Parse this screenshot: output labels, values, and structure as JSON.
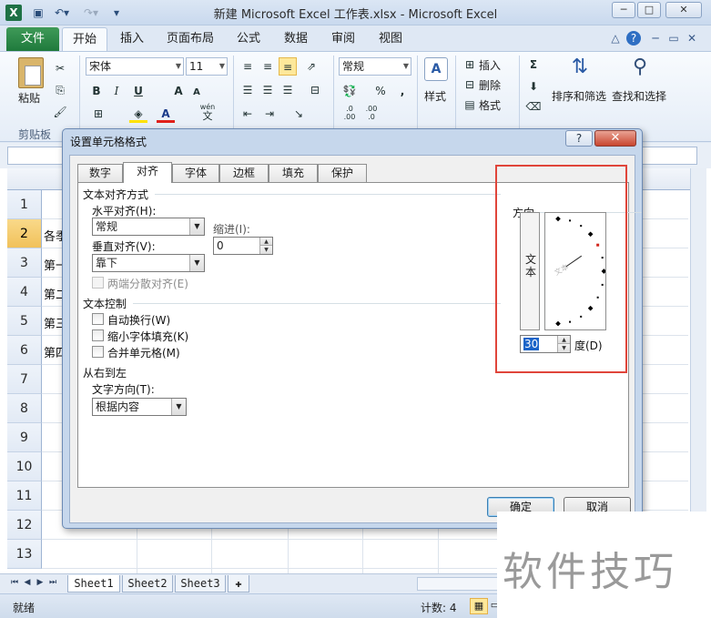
{
  "window": {
    "app_icon": "X",
    "title": "新建 Microsoft Excel 工作表.xlsx - Microsoft Excel",
    "qat": [
      "save-icon",
      "undo-icon",
      "redo-icon",
      "customize-icon"
    ]
  },
  "ribbon_tabs": {
    "file": "文件",
    "items": [
      "开始",
      "插入",
      "页面布局",
      "公式",
      "数据",
      "审阅",
      "视图"
    ]
  },
  "ribbon": {
    "paste": "粘贴",
    "clipboard": "剪贴板",
    "font_name": "宋体",
    "font_size": "11",
    "number_format": "常规",
    "styles": "样式",
    "insert": "插入",
    "delete": "删除",
    "format": "格式",
    "sort_filter": "排序和筛选",
    "find_select": "查找和选择",
    "bold": "B",
    "italic": "I",
    "underline": "U",
    "grow_font": "A",
    "shrink_font": "A",
    "wen": "wén",
    "wen_char": "文",
    "percent": "%",
    "comma": ",",
    "dec_inc": ".0\n.00",
    "dec_dec": ".00\n.0",
    "sigma": "Σ"
  },
  "grid": {
    "rows": [
      "1",
      "2",
      "3",
      "4",
      "5",
      "6",
      "7",
      "8",
      "9",
      "10",
      "11",
      "12",
      "13"
    ],
    "selected_row": "2",
    "cells": [
      "各季",
      "第一",
      "第二",
      "第三",
      "第四"
    ]
  },
  "sheets": [
    "Sheet1",
    "Sheet2",
    "Sheet3"
  ],
  "status": {
    "ready": "就绪",
    "count": "计数: 4"
  },
  "dialog": {
    "title": "设置单元格格式",
    "help": "?",
    "close": "✕",
    "tabs": [
      "数字",
      "对齐",
      "字体",
      "边框",
      "填充",
      "保护"
    ],
    "active_tab": "对齐",
    "text_alignment": {
      "title": "文本对齐方式",
      "horizontal_label": "水平对齐(H):",
      "horizontal_value": "常规",
      "vertical_label": "垂直对齐(V):",
      "vertical_value": "靠下",
      "indent_label": "缩进(I):",
      "indent_value": "0",
      "justify_distributed": "两端分散对齐(E)"
    },
    "text_control": {
      "title": "文本控制",
      "wrap": "自动换行(W)",
      "shrink": "缩小字体填充(K)",
      "merge": "合并单元格(M)"
    },
    "rtl": {
      "title": "从右到左",
      "direction_label": "文字方向(T):",
      "direction_value": "根据内容"
    },
    "orientation": {
      "title": "方向",
      "vertical_text": [
        "文",
        "本"
      ],
      "dial_text": "文本",
      "degrees_value": "30",
      "degrees_label": "度(D)"
    },
    "ok": "确定",
    "cancel": "取消"
  },
  "watermark": "软件技巧"
}
